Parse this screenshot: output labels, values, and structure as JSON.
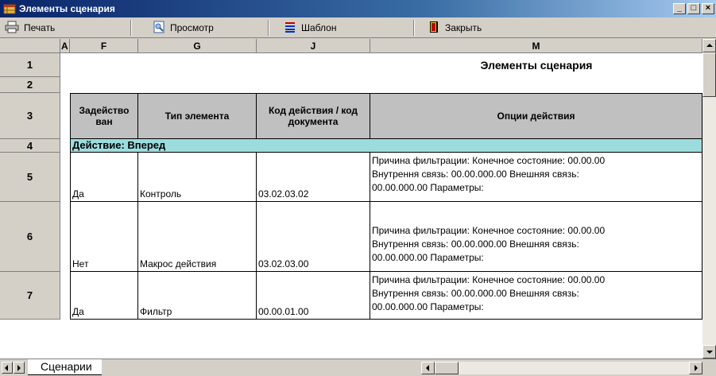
{
  "window": {
    "title": "Элементы сценария",
    "minimize_label": "_",
    "maximize_label": "□",
    "close_label": "×"
  },
  "toolbar": {
    "print_label": "Печать",
    "preview_label": "Просмотр",
    "template_label": "Шаблон",
    "close_label": "Закрыть"
  },
  "columns": [
    "A",
    "F",
    "G",
    "J",
    "M"
  ],
  "rows": [
    "1",
    "2",
    "3",
    "4",
    "5",
    "6",
    "7"
  ],
  "report": {
    "title": "Элементы сценария",
    "headers": {
      "used": "Задейство ван",
      "type": "Тип элемента",
      "code": "Код действия / код документа",
      "options": "Опции действия"
    },
    "group_label": "Действие: Вперед",
    "records": [
      {
        "used": "Да",
        "type": "Контроль",
        "code": "03.02.03.02",
        "options_line1": "Причина фильтрации:  Конечное состояние: 00.00.00",
        "options_line2": "Внутрення связь: 00.00.000.00 Внешняя связь:",
        "options_line3": "00.00.000.00 Параметры:"
      },
      {
        "used": "Нет",
        "type": "Макрос действия",
        "code": "03.02.03.00",
        "options_line1": "Причина фильтрации:  Конечное состояние: 00.00.00",
        "options_line2": "Внутрення связь: 00.00.000.00 Внешняя связь:",
        "options_line3": "00.00.000.00 Параметры:"
      },
      {
        "used": "Да",
        "type": "Фильтр",
        "code": "00.00.01.00",
        "options_line1": "Причина фильтрации:  Конечное состояние: 00.00.00",
        "options_line2": "Внутрення связь: 00.00.000.00 Внешняя связь:",
        "options_line3": "00.00.000.00 Параметры:"
      }
    ]
  },
  "sheet_tab": "Сценарии",
  "colors": {
    "title_bar": "#0a246a",
    "group_row": "#9ddcdc",
    "header_cells": "#c0c0c0",
    "chrome": "#d4d0c8"
  }
}
